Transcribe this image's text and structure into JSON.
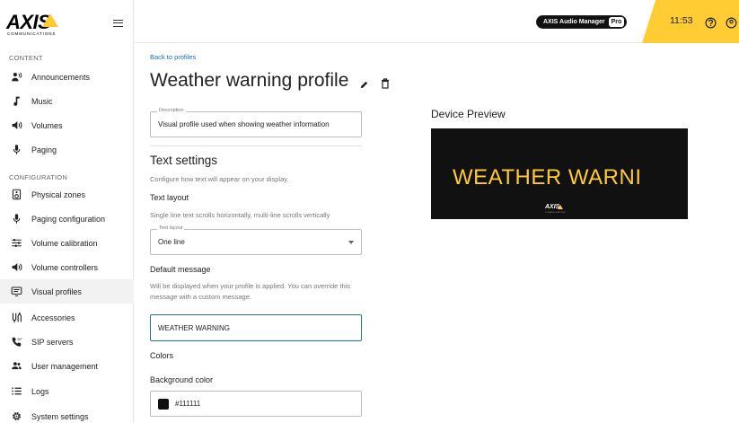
{
  "brand": {
    "logo_text": "AXIS",
    "logo_sub": "COMMUNICATIONS",
    "accent_color": "#ffcc33"
  },
  "sidebar": {
    "content_label": "CONTENT",
    "configuration_label": "CONFIGURATION",
    "content_items": [
      {
        "label": "Announcements",
        "icon": "megaphone-person-icon"
      },
      {
        "label": "Music",
        "icon": "music-note-icon"
      },
      {
        "label": "Volumes",
        "icon": "speaker-icon"
      },
      {
        "label": "Paging",
        "icon": "microphone-icon"
      }
    ],
    "config_items": [
      {
        "label": "Physical zones",
        "icon": "speaker-box-icon"
      },
      {
        "label": "Paging configuration",
        "icon": "microphone-icon"
      },
      {
        "label": "Volume calibration",
        "icon": "sliders-icon"
      },
      {
        "label": "Volume controllers",
        "icon": "speaker-icon"
      },
      {
        "label": "Visual profiles",
        "icon": "display-icon",
        "active": true
      },
      {
        "label": "Accessories",
        "icon": "accessories-icon"
      },
      {
        "label": "SIP servers",
        "icon": "phone-sip-icon"
      },
      {
        "label": "User management",
        "icon": "users-icon"
      },
      {
        "label": "Logs",
        "icon": "list-icon"
      },
      {
        "label": "System settings",
        "icon": "gear-icon"
      }
    ]
  },
  "topbar": {
    "product_name": "AXIS Audio Manager",
    "product_tier": "Pro",
    "time": "11:53"
  },
  "main": {
    "back_link": "Back to profiles",
    "title": "Weather warning profile",
    "description": {
      "legend": "Description",
      "value": "Visual profile used when showing weather information"
    },
    "text_settings": {
      "heading": "Text settings",
      "help": "Configure how text will appear on your display.",
      "layout_heading": "Text layout",
      "layout_help": "Single line text scrolls horizontally, multi-line scrolls vertically",
      "layout_legend": "Text layout",
      "layout_value": "One line",
      "default_heading": "Default message",
      "default_help": "Will be displayed when your profile is applied. You can override this message with a custom message.",
      "default_value": "WEATHER WARNING"
    },
    "colors": {
      "heading": "Colors",
      "bg_label": "Background color",
      "bg_value": "#111111"
    }
  },
  "preview": {
    "title": "Device Preview",
    "text": "WEATHER WARNI",
    "text_color": "#ffc933",
    "bg_color": "#111111",
    "logo": "AXIS",
    "logo_sub": "COMMUNICATIONS"
  }
}
